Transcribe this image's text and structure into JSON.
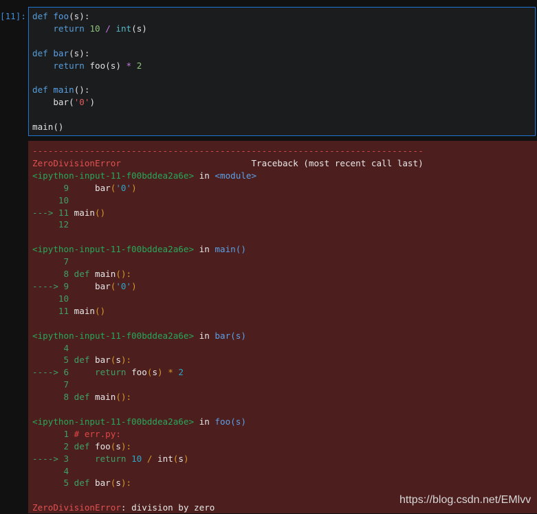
{
  "prompt": "[11]:",
  "code": {
    "l1_kw": "def",
    "l1_fn": "foo",
    "l1_rest": "(s):",
    "l2_indent": "    ",
    "l2_kw": "return",
    "l2_num": "10",
    "l2_op": "/",
    "l2_bi": "int",
    "l2_rest": "(s)",
    "l4_kw": "def",
    "l4_fn": "bar",
    "l4_rest": "(s):",
    "l5_kw": "return",
    "l5_call": "foo(s)",
    "l5_op": "*",
    "l5_num": "2",
    "l7_kw": "def",
    "l7_fn": "main",
    "l7_rest": "():",
    "l8_call": "bar(",
    "l8_str": "'0'",
    "l8_close": ")",
    "l10": "main()"
  },
  "traceback": {
    "separator": "---------------------------------------------------------------------------",
    "error_name": "ZeroDivisionError",
    "header": "Traceback (most recent call last)",
    "frames": [
      {
        "path": "<ipython-input-11-f00bddea2a6e>",
        "in": "in",
        "scope": "<module>"
      },
      {
        "path": "<ipython-input-11-f00bddea2a6e>",
        "in": "in",
        "scope": "main"
      },
      {
        "path": "<ipython-input-11-f00bddea2a6e>",
        "in": "in",
        "scope": "bar"
      },
      {
        "path": "<ipython-input-11-f00bddea2a6e>",
        "in": "in",
        "scope": "foo"
      }
    ],
    "final_error_name": "ZeroDivisionError",
    "final_message": ": division by zero"
  },
  "tb_text": {
    "f1_l9": "      9     ",
    "f1_l10": "     10",
    "f1_l11_arrow": "---> 11 ",
    "f1_l12": "     12",
    "f2_l7": "      7",
    "f2_l8": "      8 ",
    "f2_l9_arrow": "----> 9     ",
    "f2_l10": "     10",
    "f2_l11": "     11 ",
    "f3_l4": "      4",
    "f3_l5": "      5 ",
    "f3_l6_arrow": "----> 6     ",
    "f3_l7": "      7",
    "f3_l8": "      8 ",
    "f4_l1": "      1 ",
    "f4_l1_comment": "# err.py:",
    "f4_l2": "      2 ",
    "f4_l3_arrow": "----> 3     ",
    "f4_l4": "      4",
    "f4_l5": "      5 ",
    "def": "def",
    "return": "return",
    "bar": "bar",
    "foo": "foo",
    "main": "main",
    "int": "int",
    "str0": "'0'",
    "s": "s",
    "ten": "10",
    "two": "2",
    "slash": "/",
    "star": "*"
  },
  "watermark": "https://blog.csdn.net/EMlvv"
}
